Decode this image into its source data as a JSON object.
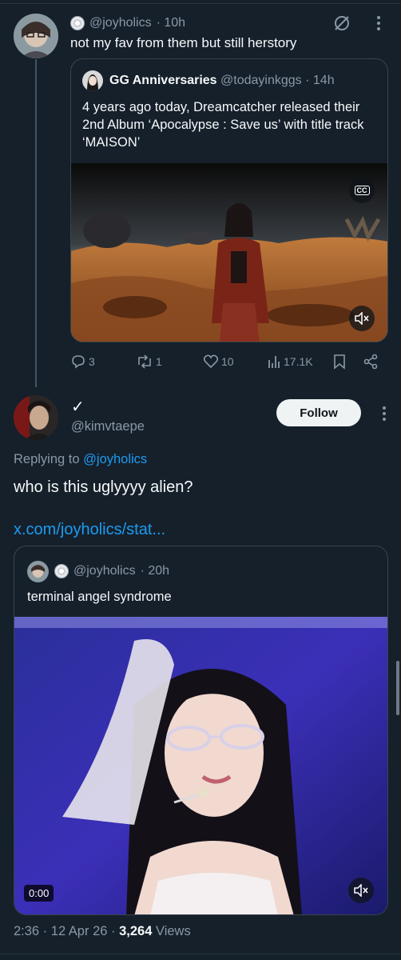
{
  "tweet1": {
    "handle": "@joyholics",
    "time": "· 10h",
    "text": "not my fav from them but still herstory"
  },
  "quote1": {
    "name": "GG Anniversaries",
    "handle": "@todayinkggs",
    "time": "· 14h",
    "text": "4 years ago today, Dreamcatcher released their 2nd Album ‘Apocalypse : Save us’ with title track ‘MAISON’",
    "cc_label": "CC"
  },
  "actions": {
    "replies": "3",
    "reposts": "1",
    "likes": "10",
    "views": "17.1K"
  },
  "reply": {
    "name": "✓",
    "handle": "@kimvtaepe",
    "follow_label": "Follow",
    "replying_prefix": "Replying to",
    "replying_to": "@joyholics",
    "text": "who is this uglyyyy alien?",
    "link": "x.com/joyholics/stat..."
  },
  "quote2": {
    "handle": "@joyholics",
    "time": "· 20h",
    "text": "terminal angel syndrome",
    "video_time": "0:00"
  },
  "footer": {
    "meta": "2:36 · 12 Apr 26 ·",
    "views_count": "3,264",
    "views_label": "Views"
  },
  "colors": {
    "background": "#15202b",
    "accent": "#1d9bf0",
    "muted": "#8b98a5"
  }
}
